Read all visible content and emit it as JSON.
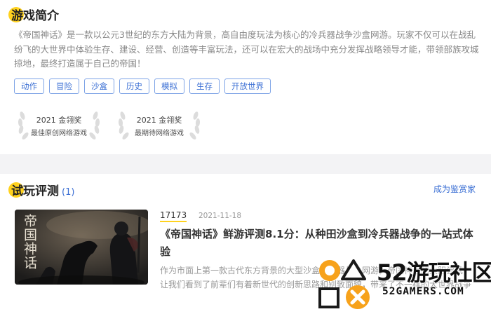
{
  "intro": {
    "title": "游戏简介",
    "text": "《帝国神话》是一款以公元3世纪的东方大陆为背景，高自由度玩法为核心的冷兵器战争沙盒网游。玩家不仅可以在战乱纷飞的大世界中体验生存、建设、经营、创造等丰富玩法，还可以在宏大的战场中充分发挥战略领导才能，带领部族攻城掠地，最终打造属于自己的帝国！",
    "tags": [
      "动作",
      "冒险",
      "沙盒",
      "历史",
      "模拟",
      "生存",
      "开放世界"
    ],
    "awards": [
      {
        "line1": "2021 金翎奖",
        "line2": "最佳原创网络游戏"
      },
      {
        "line1": "2021 金翎奖",
        "line2": "最期待网络游戏"
      }
    ]
  },
  "reviews": {
    "title": "试玩评测",
    "count": "(1)",
    "become_reviewer": "成为鉴赏家",
    "items": [
      {
        "thumb_title": "帝国神话",
        "source": "17173",
        "date": "2021-11-18",
        "headline": "《帝国神话》鲜游评测8.1分：从种田沙盒到冷兵器战争的一站式体验",
        "excerpt": "作为市面上第一款古代东方背景的大型沙盒冷兵器战争网游，帝国神话的大胆尝试，让我们看到了前辈们有着新世代的创新思路和别致面貌，带来了不一样的大世界战争体验。"
      }
    ]
  },
  "watermark": {
    "name": "52游玩社区",
    "domain": "52GAMERS.COM"
  },
  "colors": {
    "accent_yellow": "#ffd21f",
    "link_blue": "#3b6fd4",
    "divider_gray": "#f3f3f5",
    "watermark_orange": "#f7a21b"
  }
}
